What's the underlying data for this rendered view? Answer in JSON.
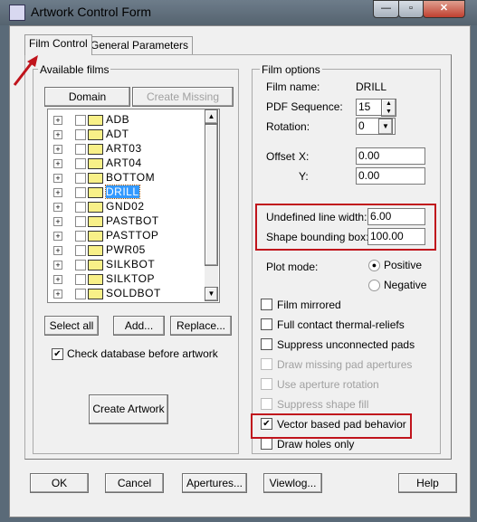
{
  "window": {
    "title": "Artwork Control Form",
    "minimize": "—",
    "maximize": "▫",
    "close": "✕"
  },
  "tabs": [
    {
      "label": "Film Control",
      "active": true
    },
    {
      "label": "General Parameters",
      "active": false
    }
  ],
  "available_films": {
    "label": "Available films",
    "domain_selection": "Domain Selection",
    "create_missing": "Create Missing Films",
    "films": [
      "ADB",
      "ADT",
      "ART03",
      "ART04",
      "BOTTOM",
      "DRILL",
      "GND02",
      "PASTBOT",
      "PASTTOP",
      "PWR05",
      "SILKBOT",
      "SILKTOP",
      "SOLDBOT",
      "SOLDTOP"
    ],
    "selected": "DRILL",
    "select_all": "Select all",
    "add": "Add...",
    "replace": "Replace...",
    "check_db": {
      "label": "Check database before artwork",
      "checked": true
    },
    "create_artwork": "Create Artwork"
  },
  "film_options": {
    "label": "Film options",
    "film_name_label": "Film name:",
    "film_name": "DRILL",
    "pdf_seq_label": "PDF Sequence:",
    "pdf_seq": "15",
    "rotation_label": "Rotation:",
    "rotation": "0",
    "offset_label": "Offset",
    "x_label": "X:",
    "x": "0.00",
    "y_label": "Y:",
    "y": "0.00",
    "undef_label": "Undefined line width:",
    "undef": "6.00",
    "shape_label": "Shape bounding box:",
    "shape": "100.00",
    "plot_mode_label": "Plot mode:",
    "positive": "Positive",
    "negative": "Negative",
    "plot_mode": "Positive",
    "checks": [
      {
        "label": "Film mirrored",
        "checked": false,
        "enabled": true
      },
      {
        "label": "Full contact thermal-reliefs",
        "checked": false,
        "enabled": true
      },
      {
        "label": "Suppress unconnected pads",
        "checked": false,
        "enabled": true
      },
      {
        "label": "Draw missing pad apertures",
        "checked": false,
        "enabled": false
      },
      {
        "label": "Use aperture rotation",
        "checked": false,
        "enabled": false
      },
      {
        "label": "Suppress shape fill",
        "checked": false,
        "enabled": false
      },
      {
        "label": "Vector based pad behavior",
        "checked": true,
        "enabled": true
      },
      {
        "label": "Draw holes only",
        "checked": false,
        "enabled": true
      }
    ]
  },
  "footer": {
    "ok": "OK",
    "cancel": "Cancel",
    "apertures": "Apertures...",
    "viewlog": "Viewlog...",
    "help": "Help"
  },
  "colors": {
    "highlight": "#c0141c",
    "selection": "#3399ff"
  }
}
